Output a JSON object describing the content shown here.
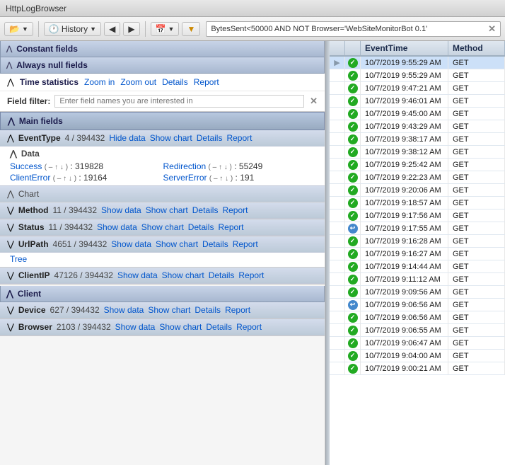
{
  "titleBar": {
    "title": "HttpLogBrowser"
  },
  "toolbar": {
    "folderBtn": "📁",
    "historyBtn": "History",
    "backBtn": "◀",
    "forwardBtn": "▶",
    "calendarBtn": "📅",
    "filterBtn": "🔽",
    "filterValue": "BytesSent<50000 AND NOT Browser='WebSiteMonitorBot 0.1'",
    "filterClose": "✕"
  },
  "leftPanel": {
    "constantFields": {
      "label": "Constant fields",
      "chevron": "⋀"
    },
    "alwaysNullFields": {
      "label": "Always null fields",
      "chevron": "⋀"
    },
    "timeStatistics": {
      "label": "Time statistics",
      "zoomIn": "Zoom in",
      "zoomOut": "Zoom out",
      "details": "Details",
      "report": "Report"
    },
    "fieldFilter": {
      "label": "Field filter:",
      "placeholder": "Enter field names you are interested in",
      "closeBtn": "✕"
    },
    "mainFields": {
      "label": "Main fields",
      "chevron": "⋀"
    },
    "eventType": {
      "label": "EventType",
      "count": "4 / 394432",
      "hideData": "Hide data",
      "showChart": "Show chart",
      "details": "Details",
      "report": "Report",
      "dataLabel": "Data",
      "values": [
        {
          "name": "Success",
          "sort": "( – ↑ ↓ )",
          "count": ": 319828"
        },
        {
          "name": "Redirection",
          "sort": "( – ↑ ↓ )",
          "count": ": 55249"
        },
        {
          "name": "ClientError",
          "sort": "( – ↑ ↓ )",
          "count": ": 19164"
        },
        {
          "name": "ServerError",
          "sort": "( – ↑ ↓ )",
          "count": ": 191"
        }
      ],
      "chartLabel": "Chart",
      "chartChevron": "⋀"
    },
    "method": {
      "label": "Method",
      "count": "11 / 394432",
      "showData": "Show data",
      "showChart": "Show chart",
      "details": "Details",
      "report": "Report"
    },
    "status": {
      "label": "Status",
      "count": "11 / 394432",
      "showData": "Show data",
      "showChart": "Show chart",
      "details": "Details",
      "report": "Report"
    },
    "urlPath": {
      "label": "UrlPath",
      "count": "4651 / 394432",
      "showData": "Show data",
      "showChart": "Show chart",
      "details": "Details",
      "report": "Report",
      "tree": "Tree"
    },
    "clientIP": {
      "label": "ClientIP",
      "count": "47126 / 394432",
      "showData": "Show data",
      "showChart": "Show chart",
      "details": "Details",
      "report": "Report"
    },
    "client": {
      "label": "Client",
      "chevron": "⋀"
    },
    "device": {
      "label": "Device",
      "count": "627 / 394432",
      "showData": "Show data",
      "showChart": "Show chart",
      "details": "Details",
      "report": "Report"
    },
    "browser": {
      "label": "Browser",
      "count": "2103 / 394432",
      "showData": "Show data",
      "showChart": "Show chart",
      "details": "Details",
      "report": "Report"
    }
  },
  "rightPanel": {
    "columns": [
      {
        "label": ""
      },
      {
        "label": ""
      },
      {
        "label": "EventTime"
      },
      {
        "label": "Method"
      }
    ],
    "rows": [
      {
        "arrow": "▶",
        "status": "green",
        "time": "10/7/2019 9:55:29 AM",
        "method": "GET",
        "selected": true
      },
      {
        "arrow": "",
        "status": "green",
        "time": "10/7/2019 9:55:29 AM",
        "method": "GET"
      },
      {
        "arrow": "",
        "status": "green",
        "time": "10/7/2019 9:47:21 AM",
        "method": "GET"
      },
      {
        "arrow": "",
        "status": "green",
        "time": "10/7/2019 9:46:01 AM",
        "method": "GET"
      },
      {
        "arrow": "",
        "status": "green",
        "time": "10/7/2019 9:45:00 AM",
        "method": "GET"
      },
      {
        "arrow": "",
        "status": "green",
        "time": "10/7/2019 9:43:29 AM",
        "method": "GET"
      },
      {
        "arrow": "",
        "status": "green",
        "time": "10/7/2019 9:38:17 AM",
        "method": "GET"
      },
      {
        "arrow": "",
        "status": "green",
        "time": "10/7/2019 9:38:12 AM",
        "method": "GET"
      },
      {
        "arrow": "",
        "status": "green",
        "time": "10/7/2019 9:25:42 AM",
        "method": "GET"
      },
      {
        "arrow": "",
        "status": "green",
        "time": "10/7/2019 9:22:23 AM",
        "method": "GET"
      },
      {
        "arrow": "",
        "status": "green",
        "time": "10/7/2019 9:20:06 AM",
        "method": "GET"
      },
      {
        "arrow": "",
        "status": "green",
        "time": "10/7/2019 9:18:57 AM",
        "method": "GET"
      },
      {
        "arrow": "",
        "status": "green",
        "time": "10/7/2019 9:17:56 AM",
        "method": "GET"
      },
      {
        "arrow": "",
        "status": "blue",
        "time": "10/7/2019 9:17:55 AM",
        "method": "GET"
      },
      {
        "arrow": "",
        "status": "green",
        "time": "10/7/2019 9:16:28 AM",
        "method": "GET"
      },
      {
        "arrow": "",
        "status": "green",
        "time": "10/7/2019 9:16:27 AM",
        "method": "GET"
      },
      {
        "arrow": "",
        "status": "green",
        "time": "10/7/2019 9:14:44 AM",
        "method": "GET"
      },
      {
        "arrow": "",
        "status": "green",
        "time": "10/7/2019 9:11:12 AM",
        "method": "GET"
      },
      {
        "arrow": "",
        "status": "green",
        "time": "10/7/2019 9:09:56 AM",
        "method": "GET"
      },
      {
        "arrow": "",
        "status": "blue",
        "time": "10/7/2019 9:06:56 AM",
        "method": "GET"
      },
      {
        "arrow": "",
        "status": "green",
        "time": "10/7/2019 9:06:56 AM",
        "method": "GET"
      },
      {
        "arrow": "",
        "status": "green",
        "time": "10/7/2019 9:06:55 AM",
        "method": "GET"
      },
      {
        "arrow": "",
        "status": "green",
        "time": "10/7/2019 9:06:47 AM",
        "method": "GET"
      },
      {
        "arrow": "",
        "status": "green",
        "time": "10/7/2019 9:04:00 AM",
        "method": "GET"
      },
      {
        "arrow": "",
        "status": "green",
        "time": "10/7/2019 9:00:21 AM",
        "method": "GET"
      }
    ]
  }
}
